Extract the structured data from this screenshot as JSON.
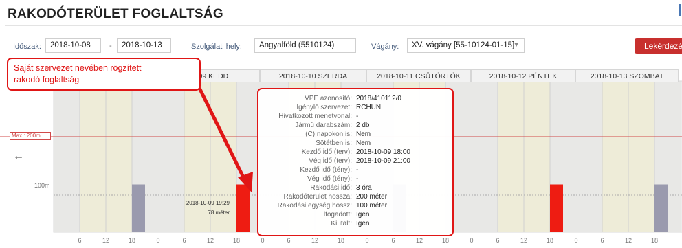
{
  "page": {
    "title": "RAKODÓTERÜLET FOGLALTSÁG"
  },
  "filters": {
    "period_label": "Időszak:",
    "date_from": "2018-10-08",
    "date_sep": "-",
    "date_to": "2018-10-13",
    "service_label": "Szolgálati hely:",
    "service_value": "Angyalföld (5510124)",
    "track_label": "Vágány:",
    "track_value": "XV. vágány [55-10124-01-15]",
    "query_button": "Lekérdezé"
  },
  "days": [
    "-09 KEDD",
    "2018-10-10 SZERDA",
    "2018-10-11 CSÜTÖRTÖK",
    "2018-10-12 PÉNTEK",
    "2018-10-13 SZOMBAT"
  ],
  "annotation": {
    "line1": "Saját szervezet nevében rögzített",
    "line2": "rakodó foglaltság"
  },
  "chart": {
    "max_label": "Max.: 200m",
    "y_label_100": "100m",
    "bar_time": "2018-10-09 19:29",
    "bar_length": "78 méter",
    "x_ticks": [
      "6",
      "12",
      "18",
      "0",
      "6",
      "12",
      "18",
      "0",
      "6",
      "12",
      "18",
      "0",
      "6",
      "12",
      "18",
      "0",
      "6",
      "12",
      "18",
      "0",
      "6",
      "12",
      "18"
    ],
    "colors": {
      "own": "#ee1c12",
      "other": "#9a9aae",
      "max_line": "#d14a4a"
    }
  },
  "chart_data": {
    "type": "bar",
    "unit": "méter",
    "max_capacity": 200,
    "y_ticks": [
      100
    ],
    "occupancies": [
      {
        "day": "2018-10-08",
        "hour": 18,
        "value": 100,
        "series": "other"
      },
      {
        "day": "2018-10-09",
        "hour": 18,
        "value": 100,
        "series": "own"
      },
      {
        "day": "2018-10-11",
        "hour": 6,
        "value": 100,
        "series": "other"
      },
      {
        "day": "2018-10-12",
        "hour": 18,
        "value": 100,
        "series": "own"
      },
      {
        "day": "2018-10-13",
        "hour": 18,
        "value": 100,
        "series": "other"
      }
    ]
  },
  "popup": [
    {
      "k": "VPE azonosító:",
      "v": "2018/410112/0"
    },
    {
      "k": "Igénylő szervezet:",
      "v": "RCHUN"
    },
    {
      "k": "Hivatkozott menetvonal:",
      "v": "-"
    },
    {
      "k": "Jármű darabszám:",
      "v": "2 db"
    },
    {
      "k": "(C) napokon is:",
      "v": "Nem"
    },
    {
      "k": "Sötétben is:",
      "v": "Nem"
    },
    {
      "k": "Kezdő idő (terv):",
      "v": "2018-10-09 18:00"
    },
    {
      "k": "Vég idő (terv):",
      "v": "2018-10-09 21:00"
    },
    {
      "k": "Kezdő idő (tény):",
      "v": "-"
    },
    {
      "k": "Vég idő (tény):",
      "v": "-"
    },
    {
      "k": "Rakodási idő:",
      "v": "3 óra"
    },
    {
      "k": "Rakodóterület hossza:",
      "v": "200 méter"
    },
    {
      "k": "Rakodási egység hossz:",
      "v": "100 méter"
    },
    {
      "k": "Elfogadott:",
      "v": "Igen"
    },
    {
      "k": "Kiutalt:",
      "v": "Igen"
    }
  ]
}
